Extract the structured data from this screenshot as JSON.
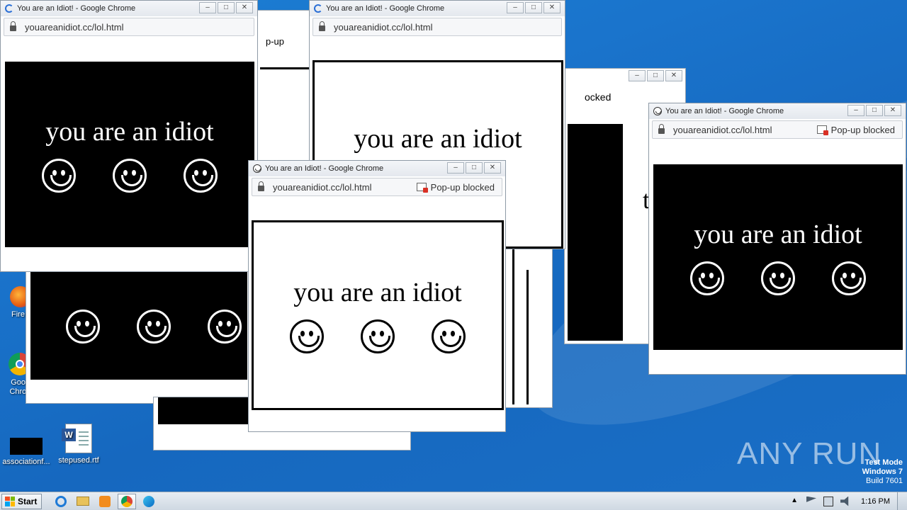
{
  "popup": {
    "title": "You are an Idiot! - Google Chrome",
    "url": "youareanidiot.cc/lol.html",
    "blocked": "Pop-up blocked",
    "slogan": "you are an idiot"
  },
  "desktop": {
    "icons": [
      {
        "label": "Fire",
        "icon": "firefox-icon"
      },
      {
        "label": "Google Chrome",
        "icon": "chrome-icon"
      },
      {
        "label": "associationf...",
        "icon": "black-file-icon"
      },
      {
        "label": "stepused.rtf",
        "icon": "word-doc-icon"
      }
    ],
    "watermark": "ANY RUN",
    "test_mode": {
      "line1": "Test Mode",
      "line2": "Windows 7",
      "line3": "Build 7601"
    }
  },
  "fragments": {
    "popup_text": "p-up",
    "blocked_partial": "ocked",
    "blocked_partial2": "ked",
    "letter_t": "t"
  },
  "taskbar": {
    "start_label": "Start",
    "clock": "1:16 PM",
    "pinned": [
      "ie-icon",
      "explorer-icon",
      "media-player-icon",
      "chrome-icon",
      "edge-icon"
    ]
  },
  "colors": {
    "desktop": "#1a74cc",
    "popup_dark_bg": "#000000",
    "popup_light_bg": "#ffffff"
  }
}
